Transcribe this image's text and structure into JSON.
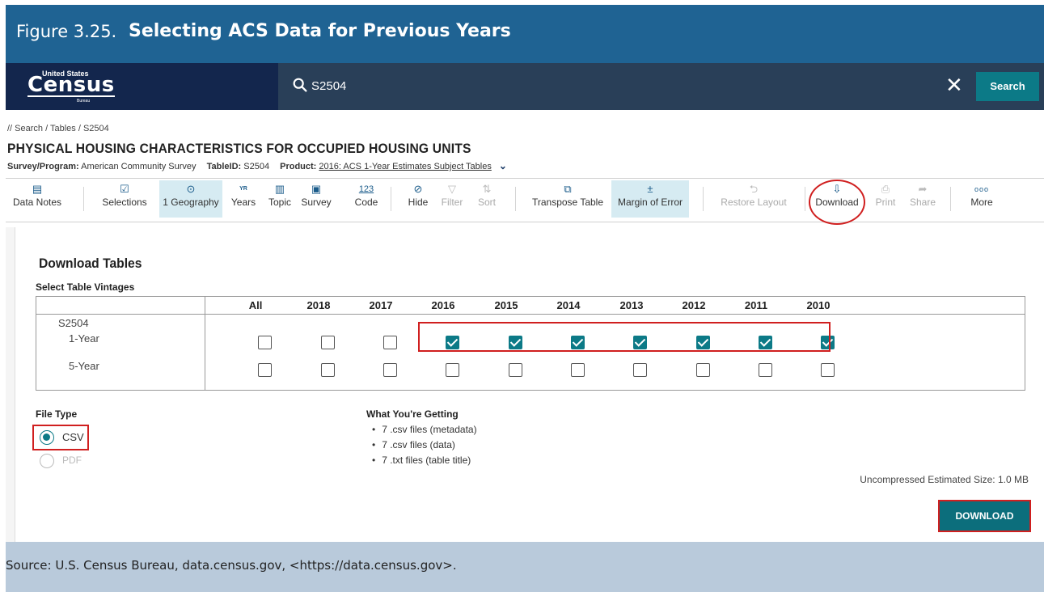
{
  "figure": {
    "number": "Figure 3.25.",
    "title": "Selecting ACS Data for Previous Years",
    "source": "Source: U.S. Census Bureau, data.census.gov, <https://data.census.gov>."
  },
  "header": {
    "logo_top": "United States",
    "logo_main": "Census",
    "logo_bottom": "Bureau",
    "search_query": "S2504",
    "search_button": "Search",
    "close_icon": "close-icon",
    "search_icon": "search-icon"
  },
  "page": {
    "breadcrumb": "// Search / Tables / S2504",
    "title": "PHYSICAL HOUSING CHARACTERISTICS FOR OCCUPIED HOUSING UNITS",
    "survey_label": "Survey/Program:",
    "survey_value": "American Community Survey",
    "tableid_label": "TableID:",
    "tableid_value": "S2504",
    "product_label": "Product:",
    "product_value": "2016: ACS 1-Year Estimates Subject Tables"
  },
  "toolbar": {
    "data_notes": "Data Notes",
    "selections": "Selections",
    "geography": "1 Geography",
    "years": "Years",
    "topic": "Topic",
    "survey": "Survey",
    "code": "Code",
    "code_icon_text": "123",
    "years_icon_text": "YR",
    "hide": "Hide",
    "filter": "Filter",
    "sort": "Sort",
    "transpose": "Transpose Table",
    "moe": "Margin of Error",
    "restore": "Restore Layout",
    "download": "Download",
    "print": "Print",
    "share": "Share",
    "more": "More",
    "more_icon_text": "ooo"
  },
  "download_panel": {
    "title": "Download Tables",
    "vintages_label": "Select Table Vintages",
    "columns": [
      "All",
      "2018",
      "2017",
      "2016",
      "2015",
      "2014",
      "2013",
      "2012",
      "2011",
      "2010"
    ],
    "table_id": "S2504",
    "rows": [
      {
        "label": "1-Year",
        "checked": [
          false,
          false,
          false,
          true,
          true,
          true,
          true,
          true,
          true,
          true
        ]
      },
      {
        "label": "5-Year",
        "checked": [
          false,
          false,
          false,
          false,
          false,
          false,
          false,
          false,
          false,
          false
        ]
      }
    ],
    "file_type_label": "File Type",
    "file_types": [
      {
        "label": "CSV",
        "selected": true
      },
      {
        "label": "PDF",
        "selected": false
      }
    ],
    "getting_label": "What You're Getting",
    "getting_items": [
      "7 .csv files (metadata)",
      "7 .csv files (data)",
      "7 .txt files (table title)"
    ],
    "estimated_size": "Uncompressed Estimated Size: 1.0 MB",
    "download_button": "DOWNLOAD"
  },
  "colors": {
    "figure_header": "#1f6393",
    "census_nav": "#13264d",
    "search_bar": "#293f58",
    "accent_teal": "#0c7a87",
    "highlight_red": "#d01f1f",
    "source_bar": "#b9cadb"
  }
}
